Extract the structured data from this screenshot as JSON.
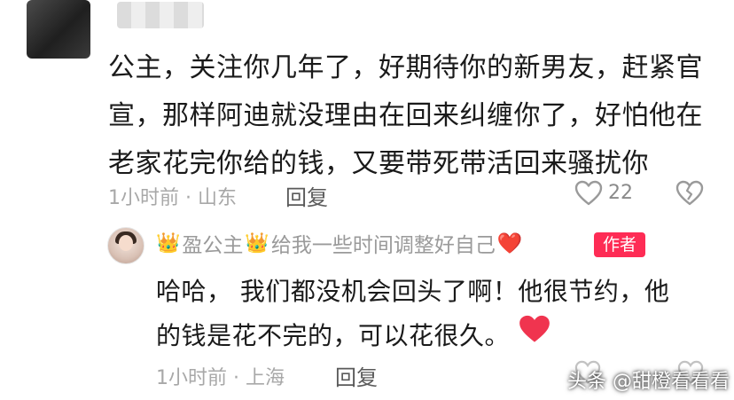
{
  "comment": {
    "text_line1": "公主，关注你几年了，好期待你的新男友，赶紧官",
    "text_line2": "宣，那样阿迪就没理由在回来纠缠你了，好怕他在",
    "text_line3": "老家花完你给的钱，又要带死带活回来骚扰你",
    "time_location": "1小时前 · 山东",
    "reply_label": "回复",
    "like_count": "22"
  },
  "reply": {
    "username_prefix": "👑",
    "username": "盈公主",
    "username_suffix": "👑",
    "bio": "给我一些时间调整好自己",
    "bio_emoji": "❤️",
    "author_badge": "作者",
    "text_line1": "哈哈，  我们都没机会回头了啊！他很节约，他",
    "text_line2": "的钱是花不完的，可以花很久。",
    "time_location": "1小时前 · 上海",
    "reply_label": "回复"
  },
  "watermark": "头条 @甜橙看看看",
  "colors": {
    "text": "#1a1a1a",
    "meta": "#a8a8a8",
    "badge": "#fe2c55",
    "heart_red": "#f0344f"
  }
}
